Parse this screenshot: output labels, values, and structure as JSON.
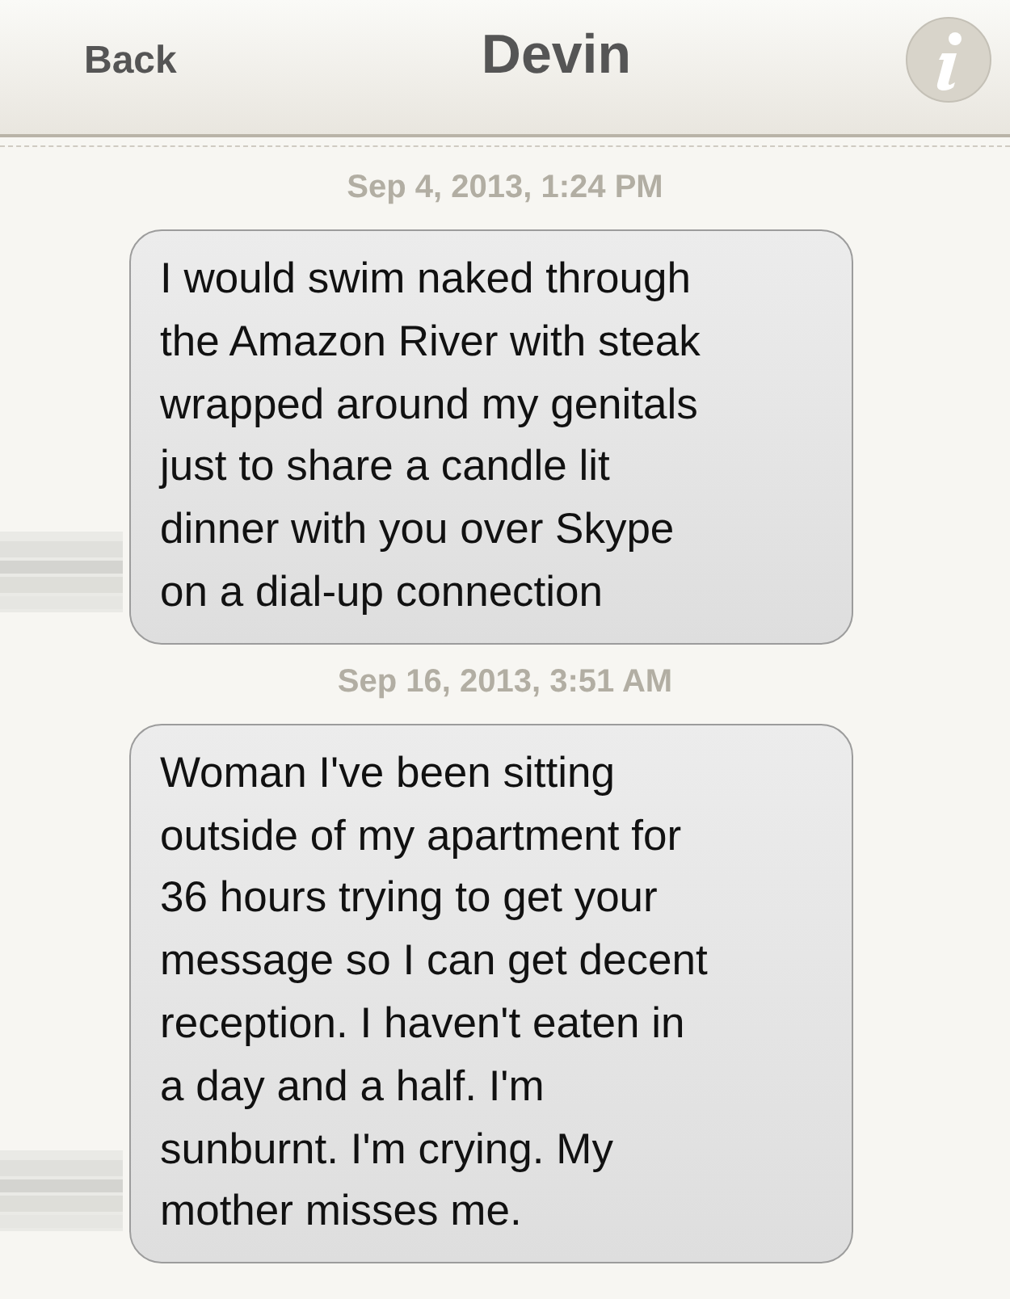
{
  "header": {
    "back_label": "Back",
    "title": "Devin"
  },
  "messages": [
    {
      "timestamp": "Sep 4, 2013, 1:24 PM",
      "text": "I would swim naked through\nthe Amazon River with steak\nwrapped around my genitals\njust to share a candle lit\ndinner with you over Skype\non a dial-up connection"
    },
    {
      "timestamp": "Sep 16, 2013, 3:51 AM",
      "text": "Woman I've been sitting\noutside of my apartment for\n36 hours trying to get your\nmessage so I can get decent\nreception. I haven't eaten in\na day and a half. I'm\nsunburnt. I'm crying. My\nmother misses me."
    }
  ]
}
